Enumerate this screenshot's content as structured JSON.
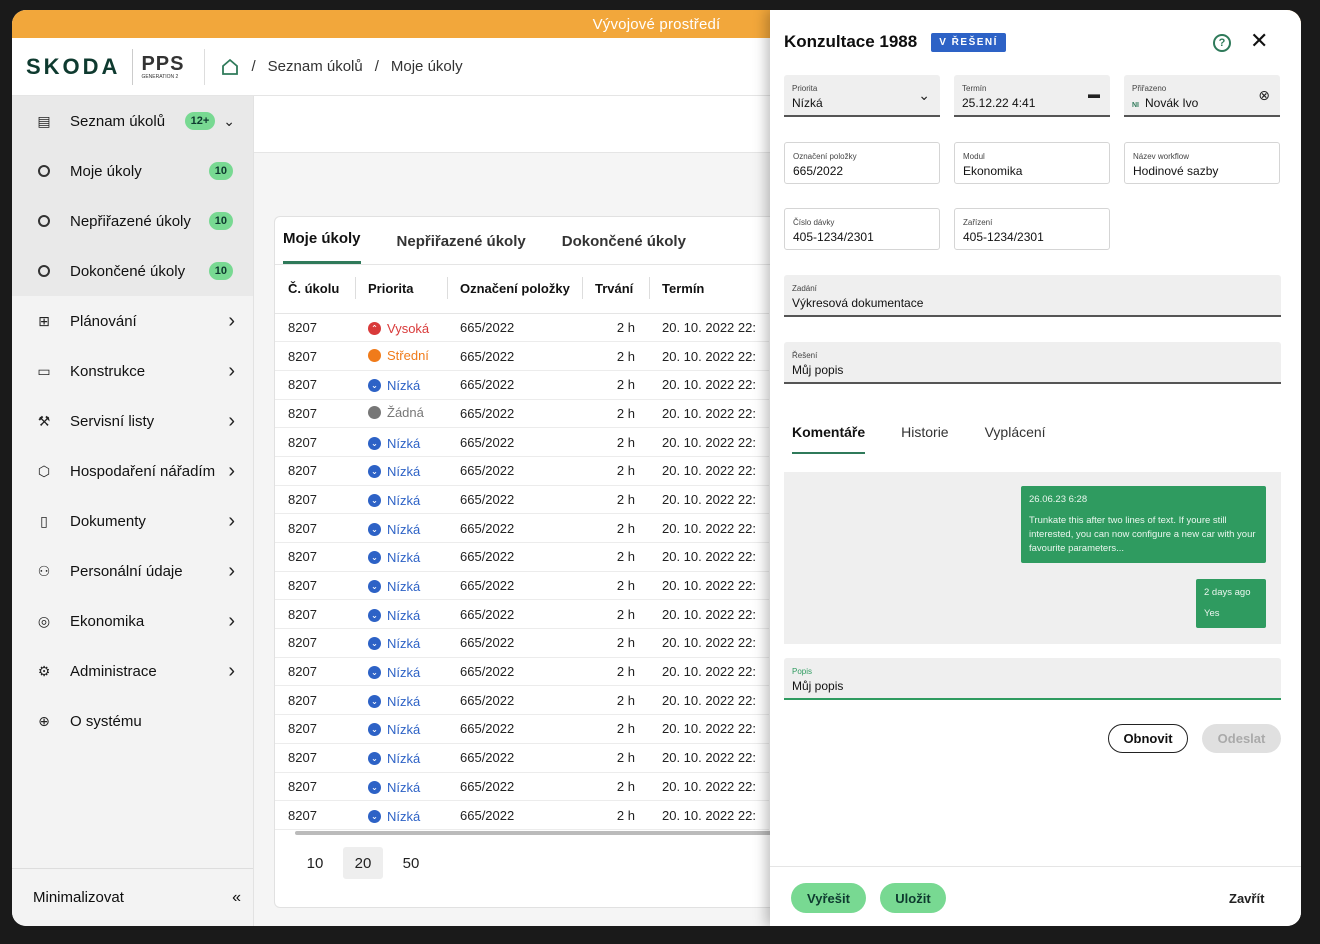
{
  "env_banner": "Vývojové prostředí",
  "header": {
    "logo": "SKODA",
    "pps_logo": "PPS",
    "pps_sub": "GENERATION 2",
    "breadcrumb": [
      "Seznam úkolů",
      "Moje úkoly"
    ]
  },
  "sidebar": {
    "group": {
      "label": "Seznam úkolů",
      "badge": "12+"
    },
    "sub_items": [
      {
        "label": "Moje úkoly",
        "badge": "10"
      },
      {
        "label": "Nepřiřazené úkoly",
        "badge": "10"
      },
      {
        "label": "Dokončené úkoly",
        "badge": "10"
      }
    ],
    "items": [
      {
        "label": "Plánování",
        "icon": "calendar-icon"
      },
      {
        "label": "Konstrukce",
        "icon": "briefcase-icon"
      },
      {
        "label": "Servisní listy",
        "icon": "wrench-icon"
      },
      {
        "label": "Hospodaření nářadím",
        "icon": "tool-icon"
      },
      {
        "label": "Dokumenty",
        "icon": "document-icon"
      },
      {
        "label": "Personální údaje",
        "icon": "person-icon"
      },
      {
        "label": "Ekonomika",
        "icon": "economy-icon"
      },
      {
        "label": "Administrace",
        "icon": "gear-icon"
      },
      {
        "label": "O systému",
        "icon": "globe-icon"
      }
    ],
    "minimize": "Minimalizovat"
  },
  "tasks": {
    "tabs": [
      "Moje úkoly",
      "Nepřiřazené úkoly",
      "Dokončené úkoly"
    ],
    "columns": [
      "Č. úkolu",
      "Priorita",
      "Označení položky",
      "Trvání",
      "Termín"
    ],
    "rows": [
      {
        "id": "8207",
        "priority": "Vysoká",
        "pcolor": "#d93a3a",
        "item": "665/2022",
        "duration": "2 h",
        "due": "20. 10. 2022 22:"
      },
      {
        "id": "8207",
        "priority": "Střední",
        "pcolor": "#f07b1a",
        "item": "665/2022",
        "duration": "2 h",
        "due": "20. 10. 2022 22:"
      },
      {
        "id": "8207",
        "priority": "Nízká",
        "pcolor": "#2d62c6",
        "item": "665/2022",
        "duration": "2 h",
        "due": "20. 10. 2022 22:"
      },
      {
        "id": "8207",
        "priority": "Žádná",
        "pcolor": "#777777",
        "item": "665/2022",
        "duration": "2 h",
        "due": "20. 10. 2022 22:"
      },
      {
        "id": "8207",
        "priority": "Nízká",
        "pcolor": "#2d62c6",
        "item": "665/2022",
        "duration": "2 h",
        "due": "20. 10. 2022 22:"
      },
      {
        "id": "8207",
        "priority": "Nízká",
        "pcolor": "#2d62c6",
        "item": "665/2022",
        "duration": "2 h",
        "due": "20. 10. 2022 22:"
      },
      {
        "id": "8207",
        "priority": "Nízká",
        "pcolor": "#2d62c6",
        "item": "665/2022",
        "duration": "2 h",
        "due": "20. 10. 2022 22:"
      },
      {
        "id": "8207",
        "priority": "Nízká",
        "pcolor": "#2d62c6",
        "item": "665/2022",
        "duration": "2 h",
        "due": "20. 10. 2022 22:"
      },
      {
        "id": "8207",
        "priority": "Nízká",
        "pcolor": "#2d62c6",
        "item": "665/2022",
        "duration": "2 h",
        "due": "20. 10. 2022 22:"
      },
      {
        "id": "8207",
        "priority": "Nízká",
        "pcolor": "#2d62c6",
        "item": "665/2022",
        "duration": "2 h",
        "due": "20. 10. 2022 22:"
      },
      {
        "id": "8207",
        "priority": "Nízká",
        "pcolor": "#2d62c6",
        "item": "665/2022",
        "duration": "2 h",
        "due": "20. 10. 2022 22:"
      },
      {
        "id": "8207",
        "priority": "Nízká",
        "pcolor": "#2d62c6",
        "item": "665/2022",
        "duration": "2 h",
        "due": "20. 10. 2022 22:"
      },
      {
        "id": "8207",
        "priority": "Nízká",
        "pcolor": "#2d62c6",
        "item": "665/2022",
        "duration": "2 h",
        "due": "20. 10. 2022 22:"
      },
      {
        "id": "8207",
        "priority": "Nízká",
        "pcolor": "#2d62c6",
        "item": "665/2022",
        "duration": "2 h",
        "due": "20. 10. 2022 22:"
      },
      {
        "id": "8207",
        "priority": "Nízká",
        "pcolor": "#2d62c6",
        "item": "665/2022",
        "duration": "2 h",
        "due": "20. 10. 2022 22:"
      },
      {
        "id": "8207",
        "priority": "Nízká",
        "pcolor": "#2d62c6",
        "item": "665/2022",
        "duration": "2 h",
        "due": "20. 10. 2022 22:"
      },
      {
        "id": "8207",
        "priority": "Nízká",
        "pcolor": "#2d62c6",
        "item": "665/2022",
        "duration": "2 h",
        "due": "20. 10. 2022 22:"
      },
      {
        "id": "8207",
        "priority": "Nízká",
        "pcolor": "#2d62c6",
        "item": "665/2022",
        "duration": "2 h",
        "due": "20. 10. 2022 22:"
      }
    ],
    "page_sizes": [
      "10",
      "20",
      "50"
    ],
    "selected_page_size": "20"
  },
  "panel": {
    "title": "Konzultace 1988",
    "status": "V ŘEŠENÍ",
    "fields": {
      "priorita": {
        "label": "Priorita",
        "value": "Nízká"
      },
      "termin": {
        "label": "Termín",
        "value": "25.12.22 4:41"
      },
      "prirazeno": {
        "label": "Přiřazeno",
        "value": "Novák Ivo",
        "initials": "NI"
      },
      "oznaceni": {
        "label": "Označení položky",
        "value": "665/2022"
      },
      "modul": {
        "label": "Modul",
        "value": "Ekonomika"
      },
      "workflow": {
        "label": "Název workflow",
        "value": "Hodinové sazby"
      },
      "davka": {
        "label": "Číslo dávky",
        "value": "405-1234/2301"
      },
      "zarizeni": {
        "label": "Zařízení",
        "value": "405-1234/2301"
      },
      "zadani": {
        "label": "Zadání",
        "value": "Výkresová dokumentace"
      },
      "reseni": {
        "label": "Řešení",
        "value": "Můj popis"
      },
      "popis": {
        "label": "Popis",
        "value": "Můj popis"
      }
    },
    "tabs": [
      "Komentáře",
      "Historie",
      "Vyplácení"
    ],
    "messages": [
      {
        "time": "26.06.23 6:28",
        "text": "Trunkate this after two lines of text. If youre still interested, you can now configure a new car with your favourite parameters..."
      },
      {
        "time": "2 days ago",
        "text": "Yes"
      }
    ],
    "buttons": {
      "refresh": "Obnovit",
      "send": "Odeslat",
      "resolve": "Vyřešit",
      "save": "Uložit",
      "close": "Zavřít"
    }
  },
  "colors": {
    "accent": "#2f7a5a",
    "badge_green": "#78d992",
    "banner": "#f2a73b",
    "status_blue": "#2d62c6",
    "chat_green": "#2f9b60"
  }
}
